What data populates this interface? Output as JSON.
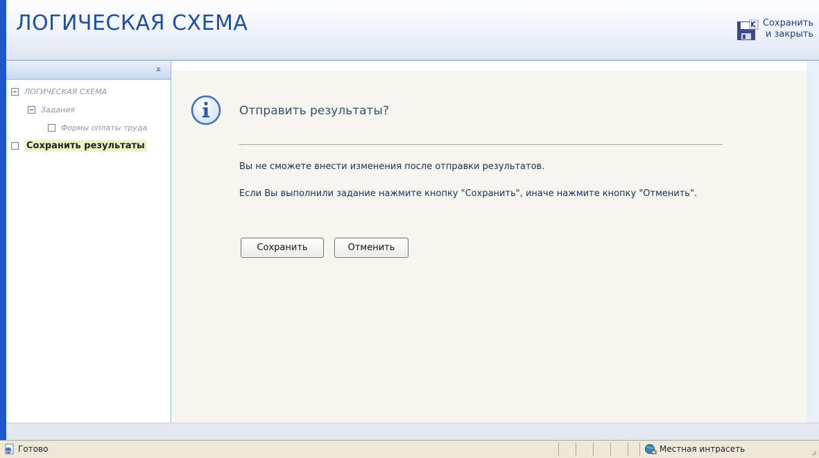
{
  "header": {
    "title": "ЛОГИЧЕСКАЯ СХЕМА",
    "save_close_line1": "Сохранить",
    "save_close_line2": "и закрыть"
  },
  "sidebar": {
    "collapse_glyph": "⌅",
    "items": [
      {
        "label": "ЛОГИЧЕСКАЯ СХЕМА",
        "style": "italic",
        "expanded": true
      },
      {
        "label": "Задания",
        "style": "italic",
        "expanded": true
      },
      {
        "label": "Формы оплаты труда",
        "style": "italic",
        "expanded": false
      },
      {
        "label": "Сохранить результаты",
        "style": "bold-selected",
        "expanded": false
      }
    ]
  },
  "dialog": {
    "icon": "info-icon",
    "title": "Отправить результаты?",
    "message_1": "Вы не сможете внести изменения после отправки результатов.",
    "message_2": "Если Вы выполнили задание нажмите кнопку \"Сохранить\", иначе нажмите кнопку \"Отменить\".",
    "save_button": "Сохранить",
    "cancel_button": "Отменить"
  },
  "statusbar": {
    "status_text": "Готово",
    "zone_text": "Местная интрасеть"
  },
  "colors": {
    "title": "#204e9d",
    "window_border": "#1f57c7",
    "selected_item_bg": "#ecf3c6",
    "content_bg": "#f6f6ee"
  }
}
